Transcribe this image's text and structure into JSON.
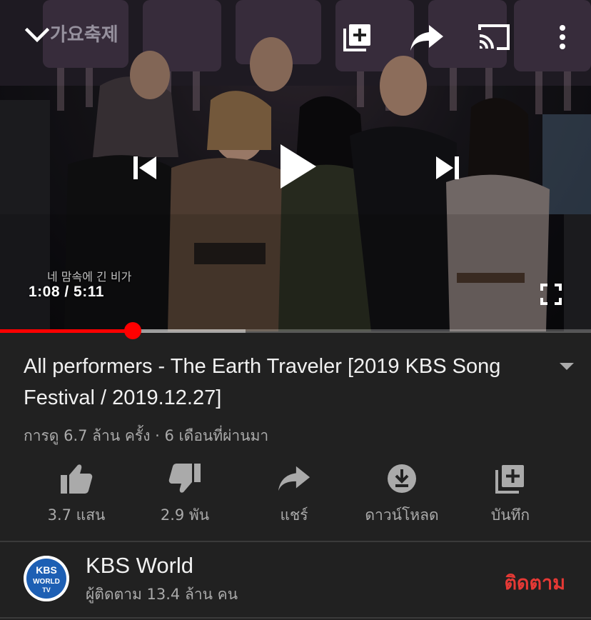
{
  "player": {
    "current_time": "1:08",
    "time_separator": " / ",
    "duration": "5:11",
    "progress_fraction": 0.225,
    "buffered_fraction": 0.415,
    "subtitle_overlay": "네 맘속에 긴 비가",
    "broadcast_logo_text": "가요축제"
  },
  "video": {
    "title": "All performers - The Earth Traveler [2019 KBS Song Festival / 2019.12.27]",
    "meta": "การดู 6.7 ล้าน ครั้ง · 6 เดือนที่ผ่านมา"
  },
  "actions": {
    "like": "3.7 แสน",
    "dislike": "2.9 พัน",
    "share": "แชร์",
    "download": "ดาวน์โหลด",
    "save": "บันทึก"
  },
  "channel": {
    "name": "KBS World",
    "subscribers": "ผู้ติดตาม 13.4 ล้าน คน",
    "subscribe_label": "ติดตาม",
    "avatar_line1": "KBS",
    "avatar_line2": "WORLD",
    "avatar_line3": "TV"
  },
  "colors": {
    "background": "#212121",
    "accent_red": "#ff0000",
    "subscribe_red": "#e53935",
    "secondary_text": "#aaaaaa"
  },
  "icons": {
    "minimize": "chevron-down-icon",
    "add_to_queue": "add-to-queue-icon",
    "share": "share-icon",
    "cast": "cast-icon",
    "more": "more-vertical-icon",
    "previous": "skip-previous-icon",
    "play": "play-icon",
    "next": "skip-next-icon",
    "fullscreen": "fullscreen-icon"
  }
}
